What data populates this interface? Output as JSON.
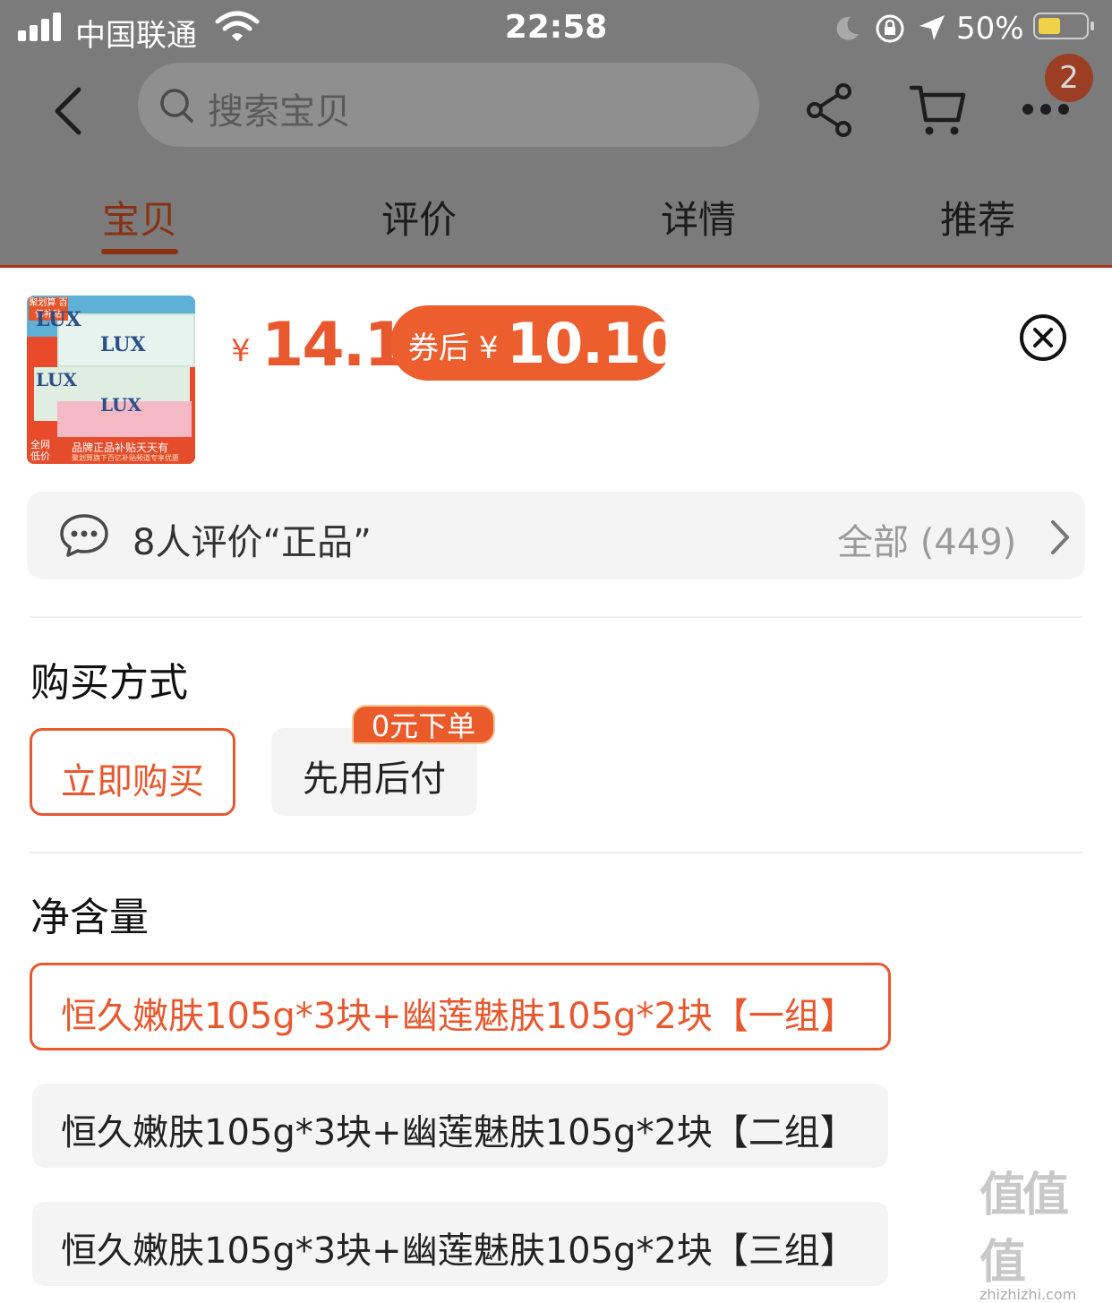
{
  "status_bar": {
    "carrier": "中国联通",
    "time": "22:58",
    "battery_percent": "50%",
    "battery_level": 0.5
  },
  "header": {
    "search_placeholder": "搜索宝贝",
    "cart_badge": "2"
  },
  "tabs": [
    {
      "label": "宝贝",
      "active": true
    },
    {
      "label": "评价",
      "active": false
    },
    {
      "label": "详情",
      "active": false
    },
    {
      "label": "推荐",
      "active": false
    }
  ],
  "product": {
    "thumb": {
      "tag": "聚划算 百亿补贴",
      "brand": "LUX",
      "footer_left": "全网 低价",
      "footer_main": "品牌正品补贴天天有",
      "footer_sub": "聚划算旗下百亿补贴频道专享优惠"
    },
    "currency": "¥",
    "price": "14.1",
    "coupon_label": "券后",
    "coupon_currency": "¥",
    "coupon_price": "10.10"
  },
  "reviews": {
    "summary": "8人评价“正品”",
    "all_label": "全部 (449)"
  },
  "purchase": {
    "title": "购买方式",
    "options": [
      {
        "label": "立即购买",
        "selected": true
      },
      {
        "label": "先用后付",
        "selected": false
      }
    ],
    "promo_tag": "0元下单"
  },
  "net_content": {
    "title": "净含量",
    "options": [
      {
        "label": "恒久嫩肤105g*3块+幽莲魅肤105g*2块【一组】",
        "selected": true
      },
      {
        "label": "恒久嫩肤105g*3块+幽莲魅肤105g*2块【二组】",
        "selected": false
      },
      {
        "label": "恒久嫩肤105g*3块+幽莲魅肤105g*2块【三组】",
        "selected": false
      }
    ]
  },
  "watermark": {
    "big": "值值值",
    "small": "zhizhizhi.com"
  },
  "colors": {
    "accent": "#e8582e",
    "overlay": "#7b7b7b",
    "card_bg": "#f4f4f4"
  }
}
